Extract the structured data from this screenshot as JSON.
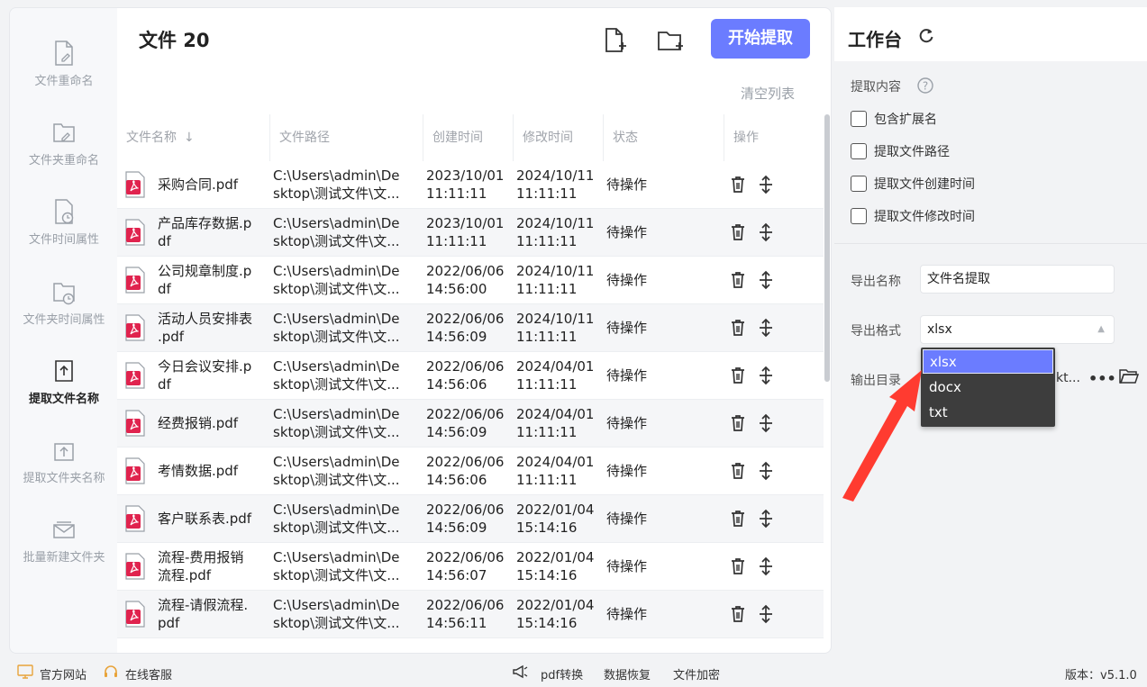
{
  "sidebar": {
    "items": [
      {
        "label": "文件重命名",
        "icon": "file-edit-icon"
      },
      {
        "label": "文件夹重命名",
        "icon": "folder-edit-icon"
      },
      {
        "label": "文件时间属性",
        "icon": "file-clock-icon"
      },
      {
        "label": "文件夹时间属性",
        "icon": "folder-clock-icon"
      },
      {
        "label": "提取文件名称",
        "icon": "file-upload-icon",
        "active": true
      },
      {
        "label": "提取文件夹名称",
        "icon": "folder-upload-icon"
      },
      {
        "label": "批量新建文件夹",
        "icon": "folder-batch-icon"
      }
    ]
  },
  "main": {
    "title": "文件 20",
    "start_button": "开始提取",
    "clear_list": "清空列表",
    "columns": [
      "文件名称",
      "文件路径",
      "创建时间",
      "修改时间",
      "状态",
      "操作"
    ],
    "rows": [
      {
        "name": "采购合同.pdf",
        "path": "C:\\Users\\admin\\De\nsktop\\测试文件\\文...",
        "ctime": "2023/10/01\n11:11:11",
        "mtime": "2024/10/11\n11:11:11",
        "status": "待操作"
      },
      {
        "name": "产品库存数据.p\ndf",
        "path": "C:\\Users\\admin\\De\nsktop\\测试文件\\文...",
        "ctime": "2023/10/01\n11:11:11",
        "mtime": "2024/10/11\n11:11:11",
        "status": "待操作"
      },
      {
        "name": "公司规章制度.p\ndf",
        "path": "C:\\Users\\admin\\De\nsktop\\测试文件\\文...",
        "ctime": "2022/06/06\n14:56:00",
        "mtime": "2024/10/11\n11:11:11",
        "status": "待操作"
      },
      {
        "name": "活动人员安排表\n.pdf",
        "path": "C:\\Users\\admin\\De\nsktop\\测试文件\\文...",
        "ctime": "2022/06/06\n14:56:09",
        "mtime": "2024/10/11\n11:11:11",
        "status": "待操作"
      },
      {
        "name": "今日会议安排.p\ndf",
        "path": "C:\\Users\\admin\\De\nsktop\\测试文件\\文...",
        "ctime": "2022/06/06\n14:56:06",
        "mtime": "2024/04/01\n11:11:11",
        "status": "待操作"
      },
      {
        "name": "经费报销.pdf",
        "path": "C:\\Users\\admin\\De\nsktop\\测试文件\\文...",
        "ctime": "2022/06/06\n14:56:09",
        "mtime": "2024/04/01\n11:11:11",
        "status": "待操作"
      },
      {
        "name": "考情数据.pdf",
        "path": "C:\\Users\\admin\\De\nsktop\\测试文件\\文...",
        "ctime": "2022/06/06\n14:56:06",
        "mtime": "2024/04/01\n11:11:11",
        "status": "待操作"
      },
      {
        "name": "客户联系表.pdf",
        "path": "C:\\Users\\admin\\De\nsktop\\测试文件\\文...",
        "ctime": "2022/06/06\n14:56:09",
        "mtime": "2022/01/04\n15:14:16",
        "status": "待操作"
      },
      {
        "name": "流程-费用报销\n流程.pdf",
        "path": "C:\\Users\\admin\\De\nsktop\\测试文件\\文...",
        "ctime": "2022/06/06\n14:56:07",
        "mtime": "2022/01/04\n15:14:16",
        "status": "待操作"
      },
      {
        "name": "流程-请假流程.\npdf",
        "path": "C:\\Users\\admin\\De\nsktop\\测试文件\\文...",
        "ctime": "2022/06/06\n14:56:11",
        "mtime": "2022/01/04\n15:14:16",
        "status": "待操作"
      }
    ]
  },
  "workspace": {
    "title": "工作台",
    "extract_label": "提取内容",
    "options": [
      {
        "label": "包含扩展名",
        "checked": false
      },
      {
        "label": "提取文件路径",
        "checked": false
      },
      {
        "label": "提取文件创建时间",
        "checked": false
      },
      {
        "label": "提取文件修改时间",
        "checked": false
      }
    ],
    "export_name_label": "导出名称",
    "export_name_value": "文件名提取",
    "export_format_label": "导出格式",
    "export_format_value": "xlsx",
    "output_dir_label": "输出目录",
    "output_dir_tail": "kt...",
    "format_options": [
      "xlsx",
      "docx",
      "txt"
    ]
  },
  "footer": {
    "website": "官方网站",
    "support": "在线客服",
    "pdf": "pdf转换",
    "recovery": "数据恢复",
    "encrypt": "文件加密",
    "version": "版本：v5.1.0"
  },
  "colors": {
    "accent": "#6b7cff",
    "pdf_red": "#e0234e",
    "arrow": "#ff3b30"
  }
}
